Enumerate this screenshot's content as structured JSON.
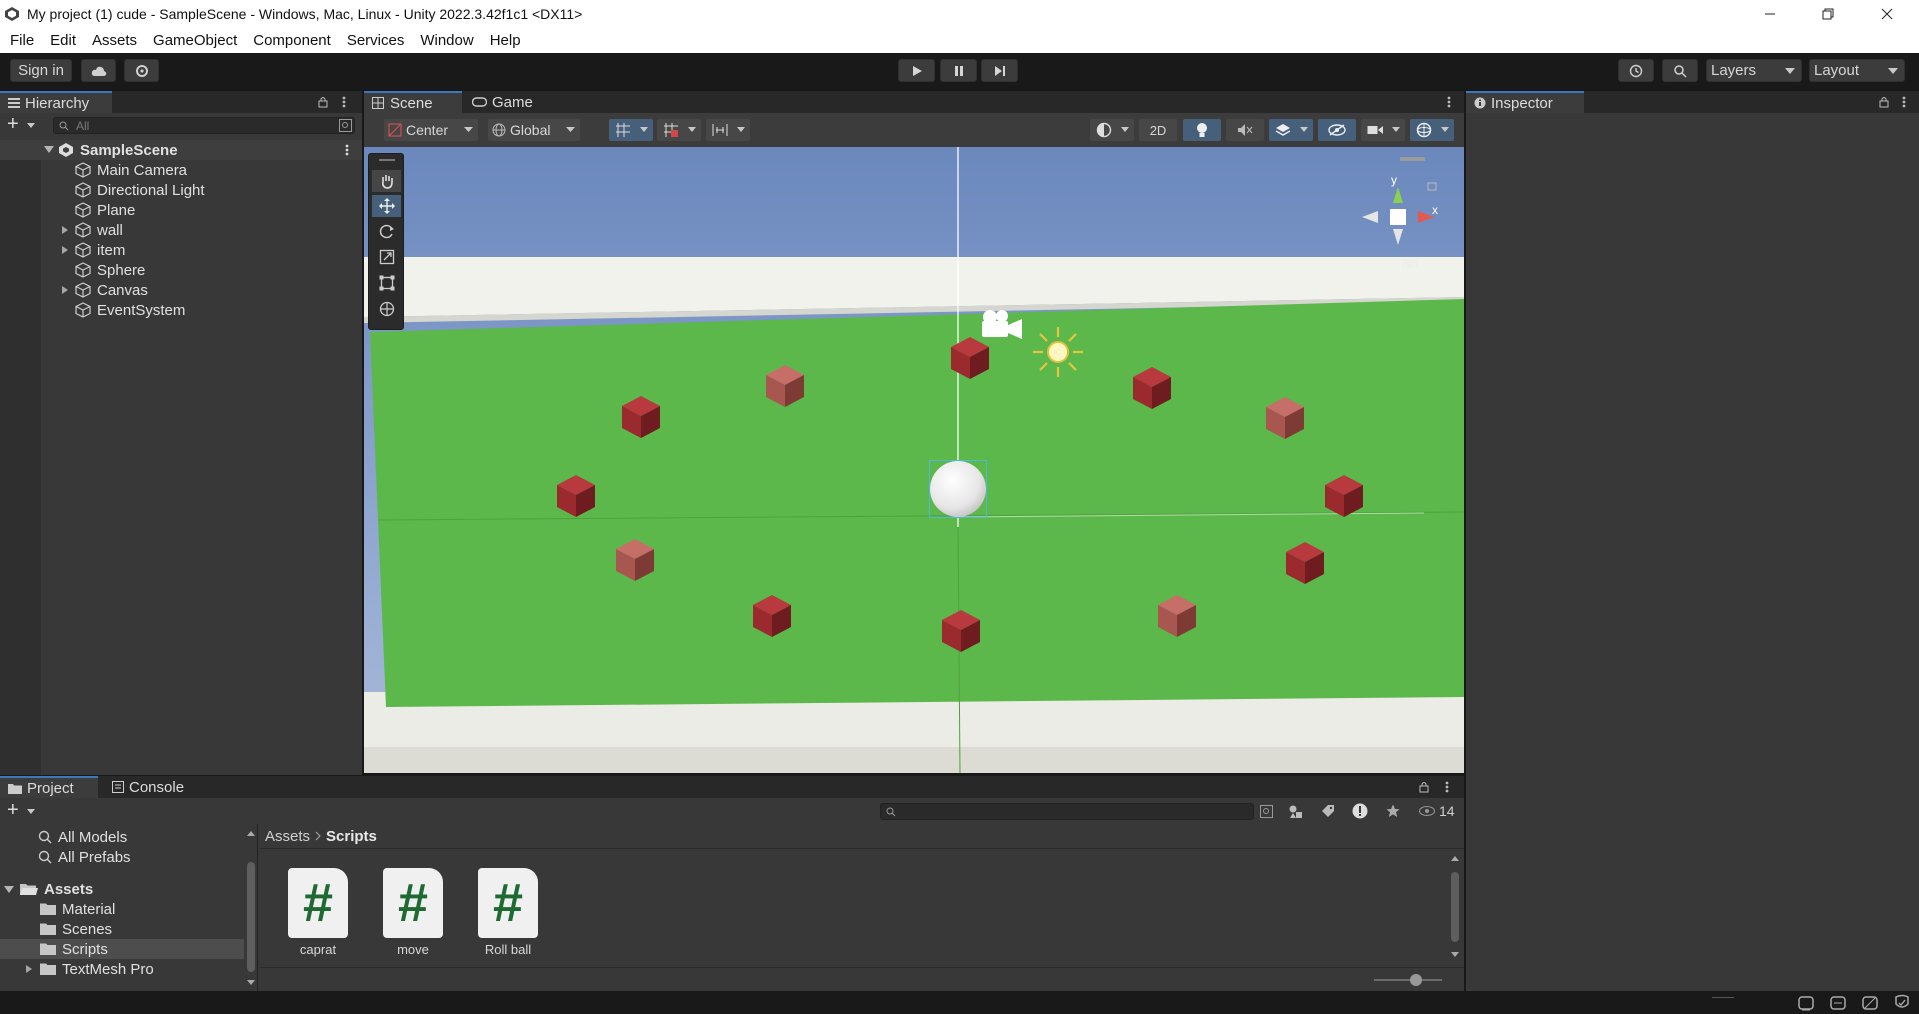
{
  "window": {
    "title": "My project (1)  cude - SampleScene - Windows, Mac, Linux - Unity 2022.3.42f1c1 <DX11>"
  },
  "menu": [
    "File",
    "Edit",
    "Assets",
    "GameObject",
    "Component",
    "Services",
    "Window",
    "Help"
  ],
  "toolbar": {
    "sign_in": "Sign in",
    "layers": "Layers",
    "layout": "Layout"
  },
  "hierarchy": {
    "tab": "Hierarchy",
    "search_placeholder": "All",
    "scene": "SampleScene",
    "items": [
      {
        "name": "Main Camera",
        "expandable": false
      },
      {
        "name": "Directional Light",
        "expandable": false
      },
      {
        "name": "Plane",
        "expandable": false
      },
      {
        "name": "wall",
        "expandable": true
      },
      {
        "name": "item",
        "expandable": true
      },
      {
        "name": "Sphere",
        "expandable": false
      },
      {
        "name": "Canvas",
        "expandable": true
      },
      {
        "name": "EventSystem",
        "expandable": false
      }
    ]
  },
  "scene_view": {
    "tabs": [
      "Scene",
      "Game"
    ],
    "pivot": "Center",
    "space": "Global",
    "mode_2d": "2D",
    "gizmo_axis_y": "y",
    "gizmo_axis_x": "x",
    "gizmo_projection": "Iso"
  },
  "inspector": {
    "tab": "Inspector"
  },
  "project": {
    "tabs": [
      "Project",
      "Console"
    ],
    "favorites": [
      "All Models",
      "All Prefabs"
    ],
    "tree_root": "Assets",
    "tree_items": [
      {
        "name": "Material",
        "expandable": false
      },
      {
        "name": "Scenes",
        "expandable": false
      },
      {
        "name": "Scripts",
        "expandable": false,
        "selected": true
      },
      {
        "name": "TextMesh Pro",
        "expandable": true
      }
    ],
    "breadcrumb": [
      "Assets",
      "Scripts"
    ],
    "hidden_count": "14",
    "assets": [
      {
        "name": "caprat",
        "icon": "#"
      },
      {
        "name": "move",
        "icon": "#"
      },
      {
        "name": "Roll ball",
        "icon": "#"
      }
    ]
  },
  "colors": {
    "accent": "#3a79bb",
    "ground": "#5cb84a",
    "sky": "#6f8fc4",
    "cube_dark": "#9a2a2e",
    "cube_light": "#c66e68",
    "script_hash": "#1e6a32"
  }
}
